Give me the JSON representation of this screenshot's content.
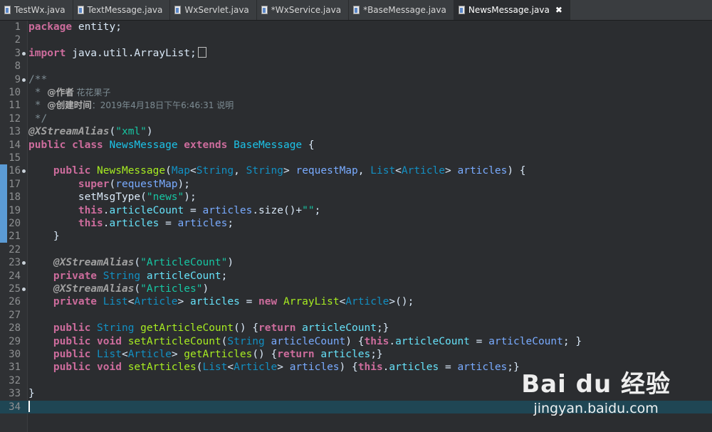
{
  "tabs": [
    {
      "label": "TestWx.java",
      "active": false
    },
    {
      "label": "TextMessage.java",
      "active": false
    },
    {
      "label": "WxServlet.java",
      "active": false
    },
    {
      "label": "*WxService.java",
      "active": false
    },
    {
      "label": "*BaseMessage.java",
      "active": false
    },
    {
      "label": "NewsMessage.java",
      "active": true
    }
  ],
  "close_symbol": "✖",
  "line_numbers": [
    "1",
    "2",
    "3",
    "8",
    "9",
    "10",
    "11",
    "12",
    "13",
    "14",
    "15",
    "16",
    "17",
    "18",
    "19",
    "20",
    "21",
    "22",
    "23",
    "24",
    "25",
    "26",
    "27",
    "28",
    "29",
    "30",
    "31",
    "32",
    "33",
    "34"
  ],
  "code": {
    "l1": [
      "package",
      " entity;"
    ],
    "l3": [
      "import",
      " java.util.ArrayList;"
    ],
    "l9": "/**",
    "l10": [
      " * ",
      "@作者",
      " 花花果子"
    ],
    "l11": [
      " * ",
      "@创建时间",
      "：2019年4月18日下午6:46:31 说明"
    ],
    "l12": " */",
    "l13": [
      "@XStreamAlias",
      "(",
      "\"xml\"",
      ")"
    ],
    "l14": [
      "public",
      " ",
      "class",
      " ",
      "NewsMessage",
      " ",
      "extends",
      " ",
      "BaseMessage",
      " {"
    ],
    "l16": [
      "    ",
      "public",
      " ",
      "NewsMessage",
      "(",
      "Map",
      "<",
      "String",
      ", ",
      "String",
      "> ",
      "requestMap",
      ", ",
      "List",
      "<",
      "Article",
      "> ",
      "articles",
      ") {"
    ],
    "l17": [
      "        ",
      "super",
      "(",
      "requestMap",
      ");"
    ],
    "l18": [
      "        setMsgType(",
      "\"news\"",
      ");"
    ],
    "l19": [
      "        ",
      "this",
      ".",
      "articleCount",
      " = ",
      "articles",
      ".size()+",
      "\"\"",
      ";"
    ],
    "l20": [
      "        ",
      "this",
      ".",
      "articles",
      " = ",
      "articles",
      ";"
    ],
    "l21": "    }",
    "l23": [
      "    ",
      "@XStreamAlias",
      "(",
      "\"ArticleCount\"",
      ")"
    ],
    "l24": [
      "    ",
      "private",
      " ",
      "String",
      " ",
      "articleCount",
      ";"
    ],
    "l25": [
      "    ",
      "@XStreamAlias",
      "(",
      "\"Articles\"",
      ")"
    ],
    "l26": [
      "    ",
      "private",
      " ",
      "List",
      "<",
      "Article",
      "> ",
      "articles",
      " = ",
      "new",
      " ",
      "ArrayList",
      "<",
      "Article",
      ">();"
    ],
    "l28": [
      "    ",
      "public",
      " ",
      "String",
      " ",
      "getArticleCount",
      "() {",
      "return",
      " ",
      "articleCount",
      ";}"
    ],
    "l29": [
      "    ",
      "public",
      " ",
      "void",
      " ",
      "setArticleCount",
      "(",
      "String",
      " ",
      "articleCount",
      ") {",
      "this",
      ".",
      "articleCount",
      " = ",
      "articleCount",
      "; }"
    ],
    "l30": [
      "    ",
      "public",
      " ",
      "List",
      "<",
      "Article",
      "> ",
      "getArticles",
      "() {",
      "return",
      " ",
      "articles",
      ";}"
    ],
    "l31": [
      "    ",
      "public",
      " ",
      "void",
      " ",
      "setArticles",
      "(",
      "List",
      "<",
      "Article",
      "> ",
      "articles",
      ") {",
      "this",
      ".",
      "articles",
      " = ",
      "articles",
      ";}"
    ],
    "l33": "}"
  },
  "watermark": {
    "logo": "Bai du 经验",
    "url": "jingyan.baidu.com"
  },
  "colors": {
    "keyword": "#cc6c9c",
    "type": "#1290c3",
    "string": "#17c6a3",
    "method": "#a7ec21",
    "field": "#66e1f8",
    "current_line": "#1f4654",
    "change_bar": "#5b9bd5"
  }
}
